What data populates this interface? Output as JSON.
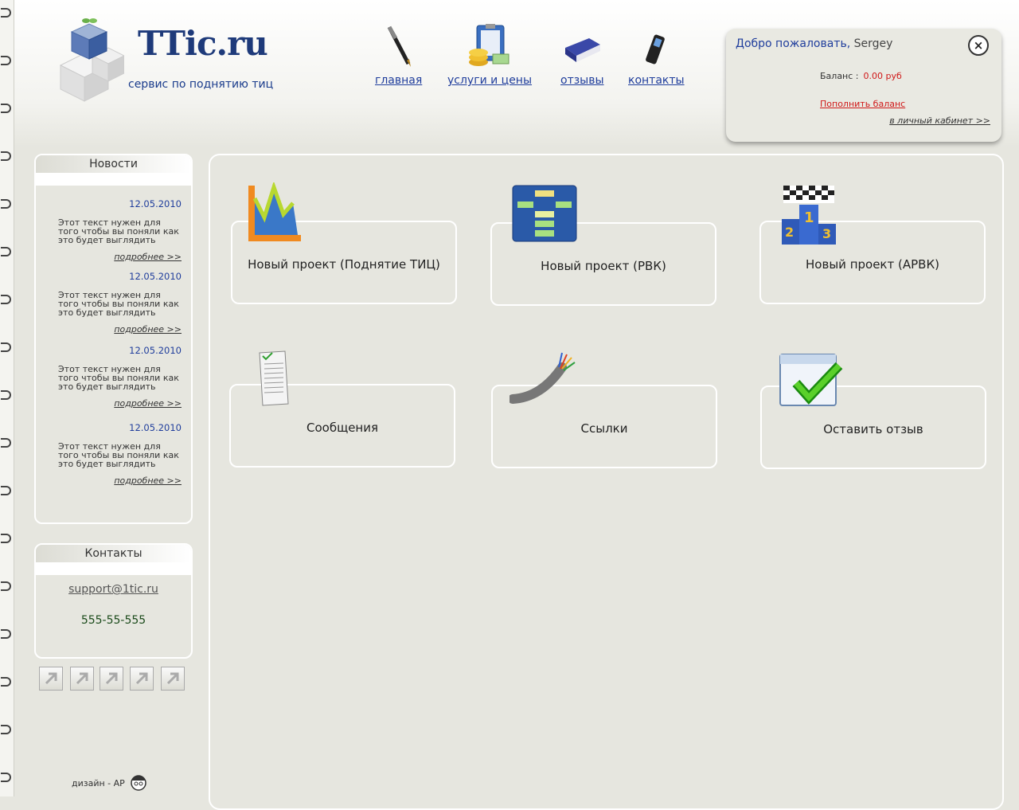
{
  "logo": {
    "text": "TTic.ru",
    "slogan": "сервис по поднятию тиц"
  },
  "nav": [
    {
      "label": "главная",
      "icon": "pen-icon"
    },
    {
      "label": "услуги и цены",
      "icon": "coins-clipboard-icon"
    },
    {
      "label": "отзывы",
      "icon": "book-icon"
    },
    {
      "label": "контакты",
      "icon": "phone-icon"
    }
  ],
  "welcome": {
    "greeting": "Добро пожаловать,",
    "user": "Sergey",
    "close": "×",
    "balance_label": "Баланс :",
    "balance_value": "0.00 руб",
    "topup": "Пополнить баланс",
    "cabinet": "в личный кабинет >>"
  },
  "news": {
    "title": "Новости",
    "items": [
      {
        "date": "12.05.2010",
        "text": "Этот текст нужен для того чтобы вы поняли как это будет выглядить",
        "more": "подробнее >>"
      },
      {
        "date": "12.05.2010",
        "text": "Этот текст нужен для того чтобы вы поняли как это будет выглядить",
        "more": "подробнее >>"
      },
      {
        "date": "12.05.2010",
        "text": "Этот текст нужен для того чтобы вы поняли как это будет выглядить",
        "more": "подробнее >>"
      },
      {
        "date": "12.05.2010",
        "text": "Этот текст нужен для того чтобы вы поняли как это будет выглядить",
        "more": "подробнее >>"
      }
    ]
  },
  "contacts": {
    "title": "Контакты",
    "email": "support@1tic.ru",
    "phone": "555-55-555"
  },
  "footer": {
    "design": "дизайн - AP"
  },
  "cards": [
    {
      "label": "Новый проект (Поднятие ТИЦ)",
      "icon": "chart-icon"
    },
    {
      "label": "Новый проект (РВК)",
      "icon": "structure-icon"
    },
    {
      "label": "Новый проект (АРВК)",
      "icon": "podium-icon"
    },
    {
      "label": "Сообщения",
      "icon": "document-icon"
    },
    {
      "label": "Ссылки",
      "icon": "cable-icon"
    },
    {
      "label": "Оставить отзыв",
      "icon": "checkmark-window-icon"
    }
  ],
  "colors": {
    "link": "#1f3d9c",
    "accent_red": "#d01818",
    "bg": "#e6e6df"
  }
}
